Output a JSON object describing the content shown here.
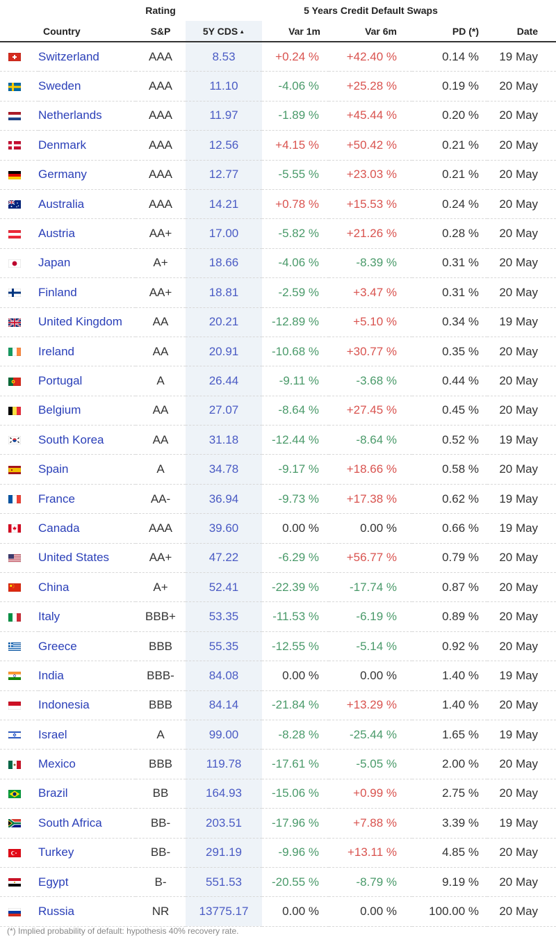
{
  "header": {
    "rating_group": "Rating",
    "cds_group": "5 Years Credit Default Swaps",
    "columns": {
      "country": "Country",
      "sp": "S&P",
      "cds": "5Y CDS",
      "var1m": "Var 1m",
      "var6m": "Var 6m",
      "pd": "PD (*)",
      "date": "Date"
    }
  },
  "rows": [
    {
      "flag": "switzerland-flag",
      "country": "Switzerland",
      "rating": "AAA",
      "cds": "8.53",
      "var1m": "+0.24 %",
      "var6m": "+42.40 %",
      "pd": "0.14 %",
      "date": "19 May"
    },
    {
      "flag": "sweden-flag",
      "country": "Sweden",
      "rating": "AAA",
      "cds": "11.10",
      "var1m": "-4.06 %",
      "var6m": "+25.28 %",
      "pd": "0.19 %",
      "date": "20 May"
    },
    {
      "flag": "netherlands-flag",
      "country": "Netherlands",
      "rating": "AAA",
      "cds": "11.97",
      "var1m": "-1.89 %",
      "var6m": "+45.44 %",
      "pd": "0.20 %",
      "date": "20 May"
    },
    {
      "flag": "denmark-flag",
      "country": "Denmark",
      "rating": "AAA",
      "cds": "12.56",
      "var1m": "+4.15 %",
      "var6m": "+50.42 %",
      "pd": "0.21 %",
      "date": "20 May"
    },
    {
      "flag": "germany-flag",
      "country": "Germany",
      "rating": "AAA",
      "cds": "12.77",
      "var1m": "-5.55 %",
      "var6m": "+23.03 %",
      "pd": "0.21 %",
      "date": "20 May"
    },
    {
      "flag": "australia-flag",
      "country": "Australia",
      "rating": "AAA",
      "cds": "14.21",
      "var1m": "+0.78 %",
      "var6m": "+15.53 %",
      "pd": "0.24 %",
      "date": "20 May"
    },
    {
      "flag": "austria-flag",
      "country": "Austria",
      "rating": "AA+",
      "cds": "17.00",
      "var1m": "-5.82 %",
      "var6m": "+21.26 %",
      "pd": "0.28 %",
      "date": "20 May"
    },
    {
      "flag": "japan-flag",
      "country": "Japan",
      "rating": "A+",
      "cds": "18.66",
      "var1m": "-4.06 %",
      "var6m": "-8.39 %",
      "pd": "0.31 %",
      "date": "20 May"
    },
    {
      "flag": "finland-flag",
      "country": "Finland",
      "rating": "AA+",
      "cds": "18.81",
      "var1m": "-2.59 %",
      "var6m": "+3.47 %",
      "pd": "0.31 %",
      "date": "20 May"
    },
    {
      "flag": "uk-flag",
      "country": "United Kingdom",
      "rating": "AA",
      "cds": "20.21",
      "var1m": "-12.89 %",
      "var6m": "+5.10 %",
      "pd": "0.34 %",
      "date": "19 May"
    },
    {
      "flag": "ireland-flag",
      "country": "Ireland",
      "rating": "AA",
      "cds": "20.91",
      "var1m": "-10.68 %",
      "var6m": "+30.77 %",
      "pd": "0.35 %",
      "date": "20 May"
    },
    {
      "flag": "portugal-flag",
      "country": "Portugal",
      "rating": "A",
      "cds": "26.44",
      "var1m": "-9.11 %",
      "var6m": "-3.68 %",
      "pd": "0.44 %",
      "date": "20 May"
    },
    {
      "flag": "belgium-flag",
      "country": "Belgium",
      "rating": "AA",
      "cds": "27.07",
      "var1m": "-8.64 %",
      "var6m": "+27.45 %",
      "pd": "0.45 %",
      "date": "20 May"
    },
    {
      "flag": "south-korea-flag",
      "country": "South Korea",
      "rating": "AA",
      "cds": "31.18",
      "var1m": "-12.44 %",
      "var6m": "-8.64 %",
      "pd": "0.52 %",
      "date": "19 May"
    },
    {
      "flag": "spain-flag",
      "country": "Spain",
      "rating": "A",
      "cds": "34.78",
      "var1m": "-9.17 %",
      "var6m": "+18.66 %",
      "pd": "0.58 %",
      "date": "20 May"
    },
    {
      "flag": "france-flag",
      "country": "France",
      "rating": "AA-",
      "cds": "36.94",
      "var1m": "-9.73 %",
      "var6m": "+17.38 %",
      "pd": "0.62 %",
      "date": "19 May"
    },
    {
      "flag": "canada-flag",
      "country": "Canada",
      "rating": "AAA",
      "cds": "39.60",
      "var1m": "0.00 %",
      "var6m": "0.00 %",
      "pd": "0.66 %",
      "date": "19 May"
    },
    {
      "flag": "usa-flag",
      "country": "United States",
      "rating": "AA+",
      "cds": "47.22",
      "var1m": "-6.29 %",
      "var6m": "+56.77 %",
      "pd": "0.79 %",
      "date": "20 May"
    },
    {
      "flag": "china-flag",
      "country": "China",
      "rating": "A+",
      "cds": "52.41",
      "var1m": "-22.39 %",
      "var6m": "-17.74 %",
      "pd": "0.87 %",
      "date": "20 May"
    },
    {
      "flag": "italy-flag",
      "country": "Italy",
      "rating": "BBB+",
      "cds": "53.35",
      "var1m": "-11.53 %",
      "var6m": "-6.19 %",
      "pd": "0.89 %",
      "date": "20 May"
    },
    {
      "flag": "greece-flag",
      "country": "Greece",
      "rating": "BBB",
      "cds": "55.35",
      "var1m": "-12.55 %",
      "var6m": "-5.14 %",
      "pd": "0.92 %",
      "date": "20 May"
    },
    {
      "flag": "india-flag",
      "country": "India",
      "rating": "BBB-",
      "cds": "84.08",
      "var1m": "0.00 %",
      "var6m": "0.00 %",
      "pd": "1.40 %",
      "date": "19 May"
    },
    {
      "flag": "indonesia-flag",
      "country": "Indonesia",
      "rating": "BBB",
      "cds": "84.14",
      "var1m": "-21.84 %",
      "var6m": "+13.29 %",
      "pd": "1.40 %",
      "date": "20 May"
    },
    {
      "flag": "israel-flag",
      "country": "Israel",
      "rating": "A",
      "cds": "99.00",
      "var1m": "-8.28 %",
      "var6m": "-25.44 %",
      "pd": "1.65 %",
      "date": "19 May"
    },
    {
      "flag": "mexico-flag",
      "country": "Mexico",
      "rating": "BBB",
      "cds": "119.78",
      "var1m": "-17.61 %",
      "var6m": "-5.05 %",
      "pd": "2.00 %",
      "date": "20 May"
    },
    {
      "flag": "brazil-flag",
      "country": "Brazil",
      "rating": "BB",
      "cds": "164.93",
      "var1m": "-15.06 %",
      "var6m": "+0.99 %",
      "pd": "2.75 %",
      "date": "20 May"
    },
    {
      "flag": "south-africa-flag",
      "country": "South Africa",
      "rating": "BB-",
      "cds": "203.51",
      "var1m": "-17.96 %",
      "var6m": "+7.88 %",
      "pd": "3.39 %",
      "date": "19 May"
    },
    {
      "flag": "turkey-flag",
      "country": "Turkey",
      "rating": "BB-",
      "cds": "291.19",
      "var1m": "-9.96 %",
      "var6m": "+13.11 %",
      "pd": "4.85 %",
      "date": "20 May"
    },
    {
      "flag": "egypt-flag",
      "country": "Egypt",
      "rating": "B-",
      "cds": "551.53",
      "var1m": "-20.55 %",
      "var6m": "-8.79 %",
      "pd": "9.19 %",
      "date": "20 May"
    },
    {
      "flag": "russia-flag",
      "country": "Russia",
      "rating": "NR",
      "cds": "13775.17",
      "var1m": "0.00 %",
      "var6m": "0.00 %",
      "pd": "100.00 %",
      "date": "20 May"
    }
  ],
  "footnote": "(*) Implied probability of default: hypothesis 40% recovery rate.",
  "colors": {
    "positive": "#d9534f",
    "negative": "#4a9a6a",
    "link": "#2a3fb8",
    "sorted_column_bg": "#eef3f8"
  }
}
